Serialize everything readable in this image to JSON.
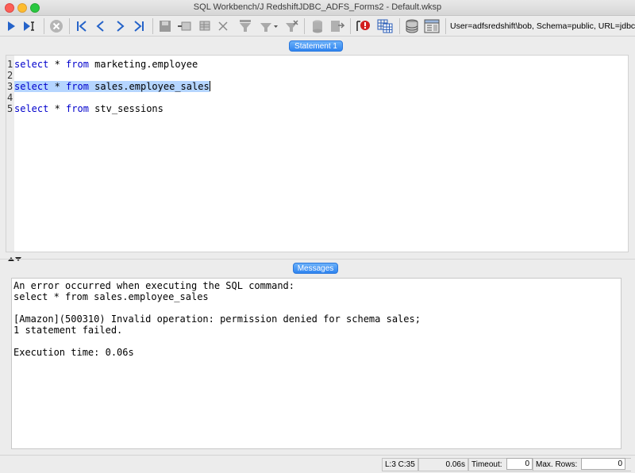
{
  "window": {
    "title": "SQL Workbench/J RedshiftJDBC_ADFS_Forms2 - Default.wksp"
  },
  "toolbar": {
    "connection_info": "User=adfsredshift\\bob, Schema=public, URL=jdbc",
    "icons": [
      "execute-icon",
      "execute-current-icon",
      "stop-icon",
      "first-icon",
      "previous-icon",
      "next-icon",
      "last-icon",
      "save-icon",
      "insert-row-icon",
      "copy-row-icon",
      "delete-row-icon",
      "filter-icon",
      "filter-dropdown-icon",
      "clear-filter-icon",
      "commit-icon",
      "rollback-icon",
      "error-icon",
      "results-grid-icon",
      "database-explorer-icon",
      "object-info-icon"
    ]
  },
  "editor": {
    "tab_label": "Statement 1",
    "lines": [
      {
        "num": "1",
        "keyword1": "select",
        "mid": " * ",
        "keyword2": "from",
        "rest": " marketing.employee"
      },
      {
        "num": "2"
      },
      {
        "num": "3",
        "keyword1": "select",
        "mid": " * ",
        "keyword2": "from",
        "rest": " sales.employee_sales"
      },
      {
        "num": "4"
      },
      {
        "num": "5",
        "keyword1": "select",
        "mid": " * ",
        "keyword2": "from",
        "rest": " stv_sessions"
      }
    ]
  },
  "messages": {
    "tab_label": "Messages",
    "lines": [
      "An error occurred when executing the SQL command:",
      "select * from sales.employee_sales",
      "",
      "[Amazon](500310) Invalid operation: permission denied for schema sales;",
      "1 statement failed.",
      "",
      "Execution time: 0.06s"
    ]
  },
  "status": {
    "cursor_pos": "L:3 C:35",
    "exec_time": "0.06s",
    "timeout_label": "Timeout:",
    "timeout_value": "0",
    "max_rows_label": "Max. Rows:",
    "max_rows_value": "0"
  }
}
